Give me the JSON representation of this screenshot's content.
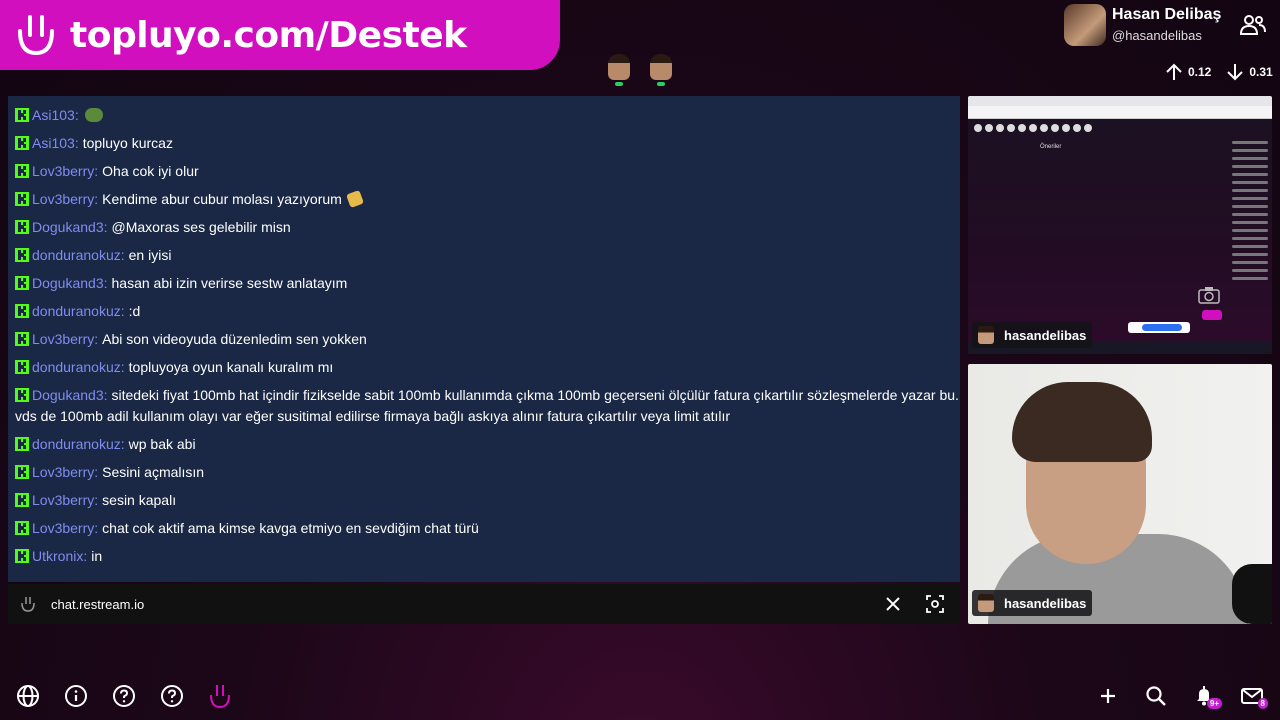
{
  "banner": {
    "url": "topluyo.com/Destek"
  },
  "profile": {
    "name": "Hasan Delibaş",
    "handle": "@hasandelibas"
  },
  "stats": {
    "up": "0.12",
    "down": "0.31"
  },
  "chat": {
    "messages": [
      {
        "user": "Asi103",
        "text": ""
      },
      {
        "user": "Asi103",
        "text": "topluyo kurcaz"
      },
      {
        "user": "Lov3berry",
        "text": "Oha cok iyi olur"
      },
      {
        "user": "Lov3berry",
        "text": "Kendime abur cubur molası yazıyorum"
      },
      {
        "user": "Dogukand3",
        "text": "@Maxoras ses gelebilir misn"
      },
      {
        "user": "donduranokuz",
        "text": "en iyisi"
      },
      {
        "user": "Dogukand3",
        "text": "hasan abi izin verirse sestw anlatayım"
      },
      {
        "user": "donduranokuz",
        "text": ":d"
      },
      {
        "user": "Lov3berry",
        "text": "Abi son videoyuda düzenledim sen yokken"
      },
      {
        "user": "donduranokuz",
        "text": "topluyoya oyun kanalı kuralım mı"
      },
      {
        "user": "Dogukand3",
        "text": "sitedeki fiyat 100mb hat içindir fizikselde sabit 100mb kullanımda çıkma 100mb geçerseni ölçülür fatura çıkartılır sözleşmelerde yazar bu. vds de 100mb adil kullanım olayı var eğer susitimal edilirse firmaya bağlı askıya alınır fatura çıkartılır veya limit atılır"
      },
      {
        "user": "donduranokuz",
        "text": "wp bak abi"
      },
      {
        "user": "Lov3berry",
        "text": "Sesini açmalısın"
      },
      {
        "user": "Lov3berry",
        "text": "sesin kapalı"
      },
      {
        "user": "Lov3berry",
        "text": "chat cok aktif ama kimse kavga etmiyo en sevdiğim chat türü"
      },
      {
        "user": "Utkronix",
        "text": "in"
      }
    ]
  },
  "chatbar": {
    "label": "chat.restream.io"
  },
  "screen": {
    "heading": "Öneriler",
    "nametag": "hasandelibas"
  },
  "camera": {
    "nametag": "hasandelibas"
  },
  "notifications": {
    "bell_badge": "9+",
    "mail_badge": "8"
  },
  "colors": {
    "accent": "#d10fbf",
    "chat_bg": "#1a2845",
    "username": "#7f8cf0",
    "kick_green": "#53fc18"
  },
  "icons": {
    "banner": "topluyo-logo",
    "bottom_left": [
      "globe-icon",
      "info-icon",
      "help-icon",
      "help-icon",
      "topluyo-icon"
    ],
    "bottom_right": [
      "plus-icon",
      "search-icon",
      "bell-icon",
      "mail-icon"
    ]
  }
}
